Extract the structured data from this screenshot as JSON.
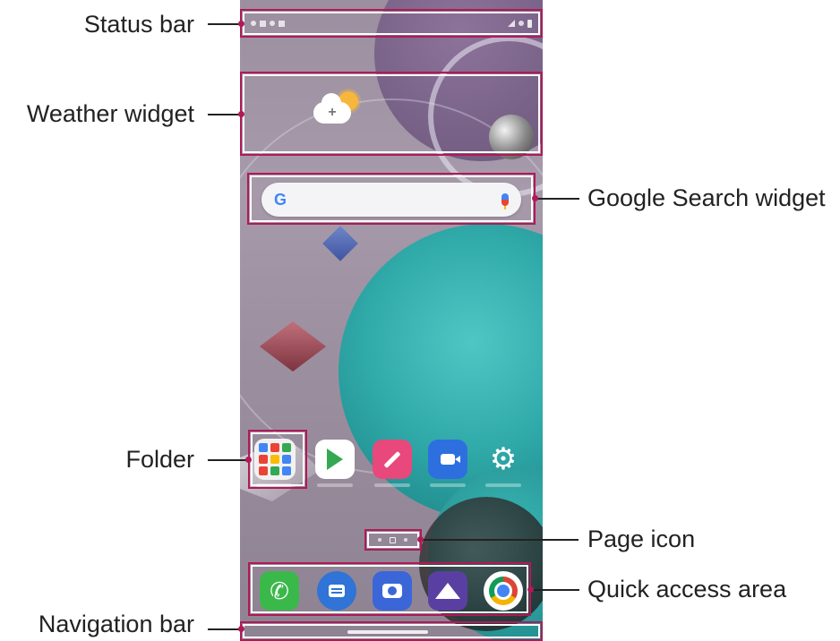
{
  "callouts": {
    "status_bar": "Status bar",
    "weather_widget": "Weather widget",
    "google_search_widget": "Google Search widget",
    "folder": "Folder",
    "page_icon": "Page icon",
    "quick_access_area": "Quick access area",
    "navigation_bar": "Navigation bar"
  },
  "search": {
    "logo": "G"
  },
  "weather": {
    "symbol": "+"
  },
  "colors": {
    "highlight": "#b01a57",
    "teal_wallpaper": "#30a9a9",
    "purple_wallpaper": "#a69aab"
  },
  "home_apps": [
    {
      "icon": "folder-icon"
    },
    {
      "icon": "play-store-icon"
    },
    {
      "icon": "pen-icon"
    },
    {
      "icon": "video-camera-icon"
    },
    {
      "icon": "settings-gear-icon"
    }
  ],
  "dock_apps": [
    {
      "icon": "phone-icon"
    },
    {
      "icon": "messages-icon"
    },
    {
      "icon": "camera-icon"
    },
    {
      "icon": "gallery-icon"
    },
    {
      "icon": "chrome-icon"
    }
  ],
  "page_indicator": {
    "pages": 3,
    "current": 2
  },
  "icons": {
    "settings": "⚙",
    "phone": "✆"
  }
}
